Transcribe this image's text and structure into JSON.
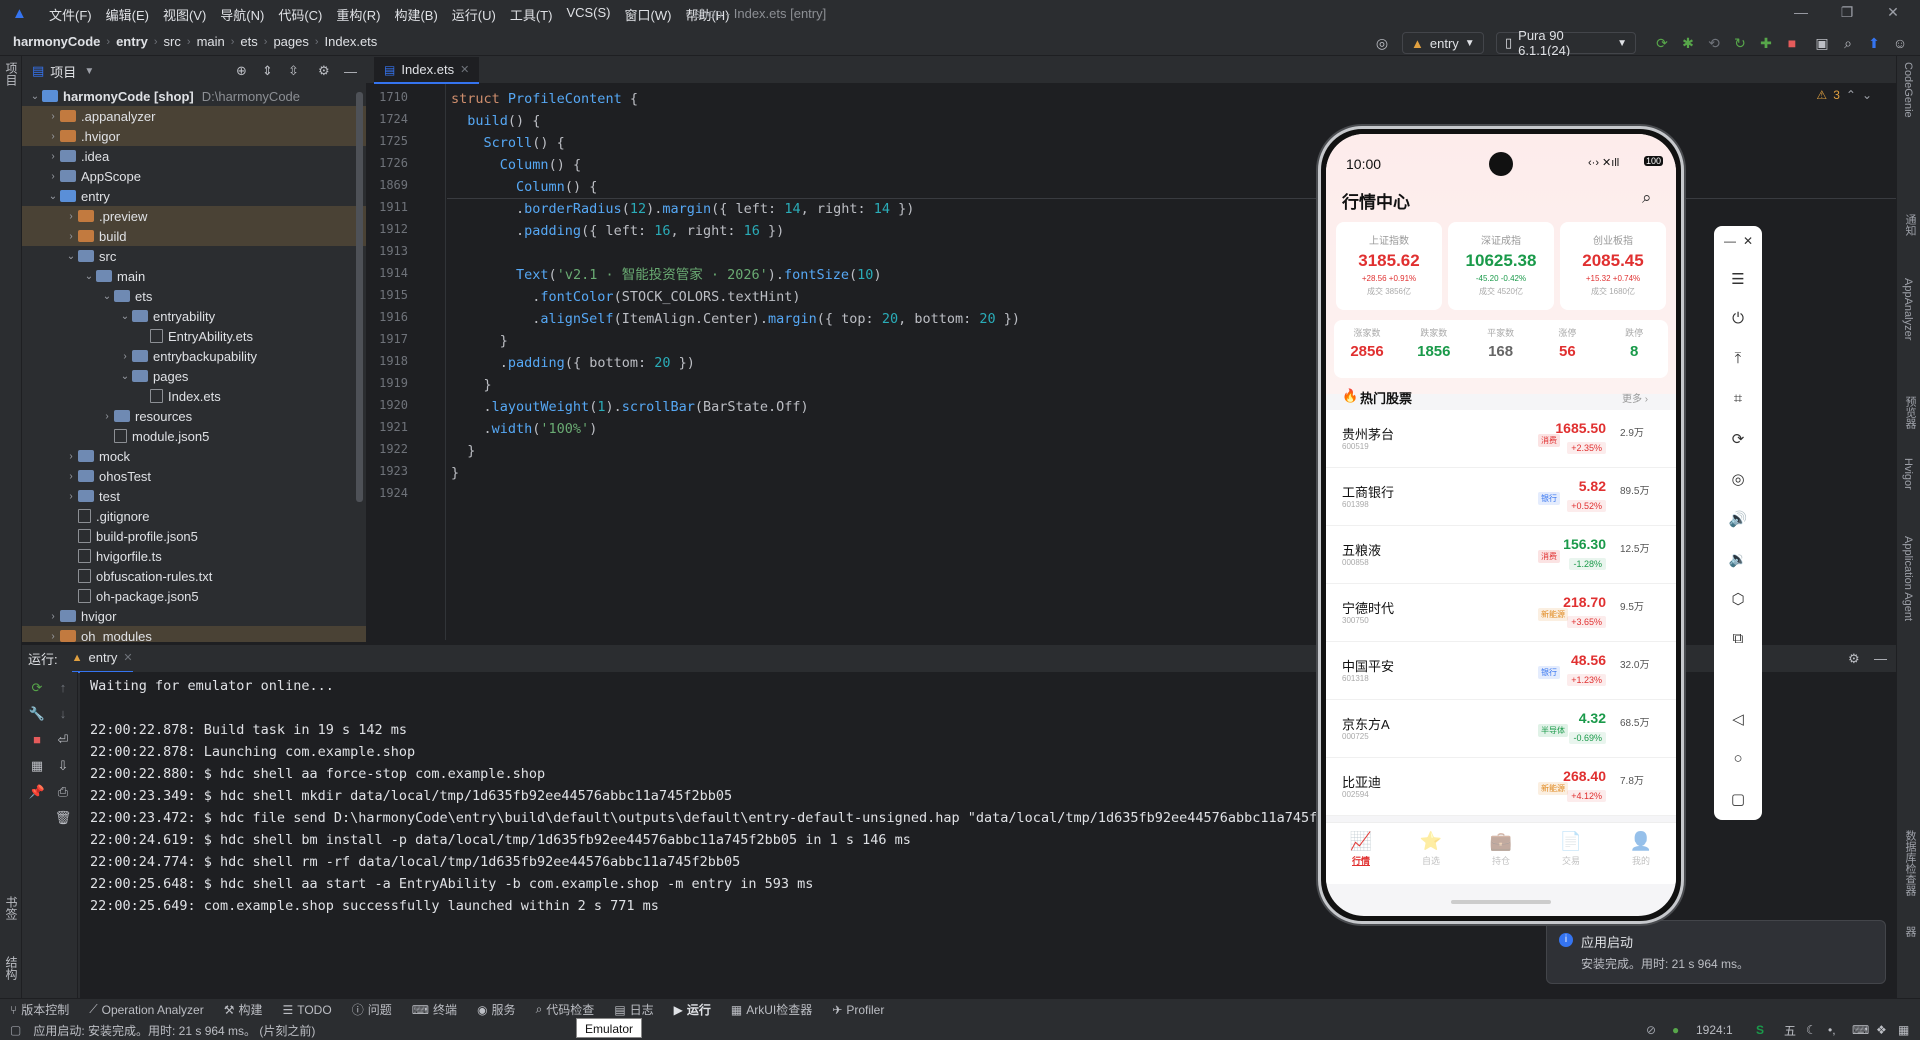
{
  "menu": {
    "items": [
      "文件(F)",
      "编辑(E)",
      "视图(V)",
      "导航(N)",
      "代码(C)",
      "重构(R)",
      "构建(B)",
      "运行(U)",
      "工具(T)",
      "VCS(S)",
      "窗口(W)",
      "帮助(H)"
    ],
    "title": "shop - Index.ets [entry]"
  },
  "breadcrumb": [
    "harmonyCode",
    "entry",
    "src",
    "main",
    "ets",
    "pages",
    "Index.ets"
  ],
  "toolbar": {
    "run_config": "entry",
    "device": "Pura 90 6.1.1(24)"
  },
  "left_strip": {
    "project": "项目",
    "bookmarks": "书签",
    "structure": "结构"
  },
  "project": {
    "header": "项目",
    "tree": [
      {
        "label": "harmonyCode [shop]",
        "path": "D:\\harmonyCode",
        "depth": 0,
        "open": true,
        "kind": "folder-blue"
      },
      {
        "label": ".appanalyzer",
        "depth": 1,
        "open": false,
        "kind": "folder-orange",
        "hl": true
      },
      {
        "label": ".hvigor",
        "depth": 1,
        "open": false,
        "kind": "folder-orange",
        "hl": true
      },
      {
        "label": ".idea",
        "depth": 1,
        "open": false,
        "kind": "folder"
      },
      {
        "label": "AppScope",
        "depth": 1,
        "open": false,
        "kind": "folder"
      },
      {
        "label": "entry",
        "depth": 1,
        "open": true,
        "kind": "folder-blue"
      },
      {
        "label": ".preview",
        "depth": 2,
        "open": false,
        "kind": "folder-orange",
        "hl": true
      },
      {
        "label": "build",
        "depth": 2,
        "open": false,
        "kind": "folder-orange",
        "hl": true
      },
      {
        "label": "src",
        "depth": 2,
        "open": true,
        "kind": "folder"
      },
      {
        "label": "main",
        "depth": 3,
        "open": true,
        "kind": "folder"
      },
      {
        "label": "ets",
        "depth": 4,
        "open": true,
        "kind": "folder"
      },
      {
        "label": "entryability",
        "depth": 5,
        "open": true,
        "kind": "folder"
      },
      {
        "label": "EntryAbility.ets",
        "depth": 6,
        "kind": "file"
      },
      {
        "label": "entrybackupability",
        "depth": 5,
        "open": false,
        "kind": "folder"
      },
      {
        "label": "pages",
        "depth": 5,
        "open": true,
        "kind": "folder"
      },
      {
        "label": "Index.ets",
        "depth": 6,
        "kind": "file"
      },
      {
        "label": "resources",
        "depth": 4,
        "open": false,
        "kind": "folder"
      },
      {
        "label": "module.json5",
        "depth": 4,
        "kind": "file"
      },
      {
        "label": "mock",
        "depth": 2,
        "open": false,
        "kind": "folder"
      },
      {
        "label": "ohosTest",
        "depth": 2,
        "open": false,
        "kind": "folder"
      },
      {
        "label": "test",
        "depth": 2,
        "open": false,
        "kind": "folder"
      },
      {
        "label": ".gitignore",
        "depth": 2,
        "kind": "file"
      },
      {
        "label": "build-profile.json5",
        "depth": 2,
        "kind": "file"
      },
      {
        "label": "hvigorfile.ts",
        "depth": 2,
        "kind": "file"
      },
      {
        "label": "obfuscation-rules.txt",
        "depth": 2,
        "kind": "file"
      },
      {
        "label": "oh-package.json5",
        "depth": 2,
        "kind": "file"
      },
      {
        "label": "hvigor",
        "depth": 1,
        "open": false,
        "kind": "folder"
      },
      {
        "label": "oh_modules",
        "depth": 1,
        "open": false,
        "kind": "folder-orange",
        "hl": true
      }
    ]
  },
  "editor": {
    "tab": "Index.ets",
    "warnings": "3",
    "sticky": [
      {
        "ln": "1710",
        "code": [
          [
            "k",
            "struct "
          ],
          [
            "t",
            "ProfileContent "
          ],
          [
            "p",
            "{"
          ]
        ]
      },
      {
        "ln": "1724",
        "code": [
          [
            "p",
            "  "
          ],
          [
            "t",
            "build"
          ],
          [
            "p",
            "() {"
          ]
        ]
      },
      {
        "ln": "1725",
        "code": [
          [
            "p",
            "    "
          ],
          [
            "t",
            "Scroll"
          ],
          [
            "p",
            "() {"
          ]
        ]
      },
      {
        "ln": "1726",
        "code": [
          [
            "p",
            "      "
          ],
          [
            "t",
            "Column"
          ],
          [
            "p",
            "() {"
          ]
        ]
      },
      {
        "ln": "1869",
        "code": [
          [
            "p",
            "        "
          ],
          [
            "t",
            "Column"
          ],
          [
            "p",
            "() {"
          ]
        ]
      }
    ],
    "lines": [
      {
        "ln": "1911",
        "code": [
          [
            "p",
            "        ."
          ],
          [
            "t",
            "borderRadius"
          ],
          [
            "p",
            "("
          ],
          [
            "n",
            "12"
          ],
          [
            "p",
            ")."
          ],
          [
            "t",
            "margin"
          ],
          [
            "p",
            "({ left: "
          ],
          [
            "n",
            "14"
          ],
          [
            "p",
            ", right: "
          ],
          [
            "n",
            "14"
          ],
          [
            "p",
            " })"
          ]
        ]
      },
      {
        "ln": "1912",
        "code": [
          [
            "p",
            "        ."
          ],
          [
            "t",
            "padding"
          ],
          [
            "p",
            "({ left: "
          ],
          [
            "n",
            "16"
          ],
          [
            "p",
            ", right: "
          ],
          [
            "n",
            "16"
          ],
          [
            "p",
            " })"
          ]
        ]
      },
      {
        "ln": "1913",
        "code": []
      },
      {
        "ln": "1914",
        "code": [
          [
            "p",
            "        "
          ],
          [
            "t",
            "Text"
          ],
          [
            "p",
            "("
          ],
          [
            "s",
            "'v2.1 · 智能投资管家 · 2026'"
          ],
          [
            "p",
            ")."
          ],
          [
            "t",
            "fontSize"
          ],
          [
            "p",
            "("
          ],
          [
            "n",
            "10"
          ],
          [
            "p",
            ")"
          ]
        ]
      },
      {
        "ln": "1915",
        "code": [
          [
            "p",
            "          ."
          ],
          [
            "t",
            "fontColor"
          ],
          [
            "p",
            "(STOCK_COLORS.textHint)"
          ]
        ]
      },
      {
        "ln": "1916",
        "code": [
          [
            "p",
            "          ."
          ],
          [
            "t",
            "alignSelf"
          ],
          [
            "p",
            "(ItemAlign.Center)."
          ],
          [
            "t",
            "margin"
          ],
          [
            "p",
            "({ top: "
          ],
          [
            "n",
            "20"
          ],
          [
            "p",
            ", bottom: "
          ],
          [
            "n",
            "20"
          ],
          [
            "p",
            " })"
          ]
        ]
      },
      {
        "ln": "1917",
        "code": [
          [
            "p",
            "      }"
          ]
        ]
      },
      {
        "ln": "1918",
        "code": [
          [
            "p",
            "      ."
          ],
          [
            "t",
            "padding"
          ],
          [
            "p",
            "({ bottom: "
          ],
          [
            "n",
            "20"
          ],
          [
            "p",
            " })"
          ]
        ]
      },
      {
        "ln": "1919",
        "code": [
          [
            "p",
            "    }"
          ]
        ]
      },
      {
        "ln": "1920",
        "code": [
          [
            "p",
            "    ."
          ],
          [
            "t",
            "layoutWeight"
          ],
          [
            "p",
            "("
          ],
          [
            "n",
            "1"
          ],
          [
            "p",
            ")."
          ],
          [
            "t",
            "scrollBar"
          ],
          [
            "p",
            "(BarState.Off)"
          ]
        ]
      },
      {
        "ln": "1921",
        "code": [
          [
            "p",
            "    ."
          ],
          [
            "t",
            "width"
          ],
          [
            "p",
            "("
          ],
          [
            "s",
            "'100%'"
          ],
          [
            "p",
            ")"
          ]
        ]
      },
      {
        "ln": "1922",
        "code": [
          [
            "p",
            "  }"
          ]
        ]
      },
      {
        "ln": "1923",
        "code": [
          [
            "p",
            "}"
          ]
        ]
      },
      {
        "ln": "1924",
        "code": []
      }
    ]
  },
  "run": {
    "label": "运行:",
    "tab": "entry",
    "console": [
      "Waiting for emulator online...",
      "",
      "22:00:22.878: Build task in 19 s 142 ms",
      "22:00:22.878: Launching com.example.shop",
      "22:00:22.880: $ hdc shell aa force-stop com.example.shop",
      "22:00:23.349: $ hdc shell mkdir data/local/tmp/1d635fb92ee44576abbc11a745f2bb05",
      "22:00:23.472: $ hdc file send D:\\harmonyCode\\entry\\build\\default\\outputs\\default\\entry-default-unsigned.hap \"data/local/tmp/1d635fb92ee44576abbc11a745f2bb",
      "22:00:24.619: $ hdc shell bm install -p data/local/tmp/1d635fb92ee44576abbc11a745f2bb05 in 1 s 146 ms",
      "22:00:24.774: $ hdc shell rm -rf data/local/tmp/1d635fb92ee44576abbc11a745f2bb05",
      "22:00:25.648: $ hdc shell aa start -a EntryAbility -b com.example.shop -m entry in 593 ms",
      "22:00:25.649: com.example.shop successfully launched within 2 s 771 ms"
    ]
  },
  "bottom_tabs": [
    "版本控制",
    "Operation Analyzer",
    "构建",
    "TODO",
    "问题",
    "终端",
    "服务",
    "代码检查",
    "日志",
    "运行",
    "ArkUI检查器",
    "Profiler"
  ],
  "status": {
    "message": "应用启动: 安装完成。用时: 21 s 964 ms。 (片刻之前)",
    "position": "1924:1",
    "tooltip": "Emulator",
    "ime": "五"
  },
  "right_strip": [
    "CodeGenie",
    "通知",
    "AppAnalyzer",
    "预览器",
    "Hvigor",
    "Application Agent",
    "数据库检查器",
    "设备文件浏览器"
  ],
  "notification": {
    "title": "应用启动",
    "body": "安装完成。用时: 21 s 964 ms。"
  },
  "phone": {
    "time": "10:00",
    "battery": "100",
    "header_title": "行情中心",
    "indices": [
      {
        "name": "上证指数",
        "value": "3185.62",
        "change": "+28.56 +0.91%",
        "volume": "成交 3856亿",
        "color": "#e03030"
      },
      {
        "name": "深证成指",
        "value": "10625.38",
        "change": "-45.20 -0.42%",
        "volume": "成交 4520亿",
        "color": "#1a9a4a"
      },
      {
        "name": "创业板指",
        "value": "2085.45",
        "change": "+15.32 +0.74%",
        "volume": "成交 1680亿",
        "color": "#e03030"
      }
    ],
    "breadth": [
      {
        "label": "涨家数",
        "value": "2856",
        "color": "#e03030"
      },
      {
        "label": "跌家数",
        "value": "1856",
        "color": "#1a9a4a"
      },
      {
        "label": "平家数",
        "value": "168",
        "color": "#666666"
      },
      {
        "label": "涨停",
        "value": "56",
        "color": "#e03030"
      },
      {
        "label": "跌停",
        "value": "8",
        "color": "#1a9a4a"
      }
    ],
    "hot_title": "热门股票",
    "more": "更多 ›",
    "stocks": [
      {
        "name": "贵州茅台",
        "code": "600519",
        "tag": "消费",
        "tag_color": "#e03030",
        "price": "1685.50",
        "pct": "+2.35%",
        "vol": "2.9万",
        "up": true
      },
      {
        "name": "工商银行",
        "code": "601398",
        "tag": "银行",
        "tag_color": "#3574f0",
        "price": "5.82",
        "pct": "+0.52%",
        "vol": "89.5万",
        "up": true
      },
      {
        "name": "五粮液",
        "code": "000858",
        "tag": "消费",
        "tag_color": "#e03030",
        "price": "156.30",
        "pct": "-1.28%",
        "vol": "12.5万",
        "up": false
      },
      {
        "name": "宁德时代",
        "code": "300750",
        "tag": "新能源",
        "tag_color": "#e08a20",
        "price": "218.70",
        "pct": "+3.65%",
        "vol": "9.5万",
        "up": true
      },
      {
        "name": "中国平安",
        "code": "601318",
        "tag": "银行",
        "tag_color": "#3574f0",
        "price": "48.56",
        "pct": "+1.23%",
        "vol": "32.0万",
        "up": true
      },
      {
        "name": "京东方A",
        "code": "000725",
        "tag": "半导体",
        "tag_color": "#1a9a4a",
        "price": "4.32",
        "pct": "-0.69%",
        "vol": "68.5万",
        "up": false
      },
      {
        "name": "比亚迪",
        "code": "002594",
        "tag": "新能源",
        "tag_color": "#e08a20",
        "price": "268.40",
        "pct": "+4.12%",
        "vol": "7.8万",
        "up": true
      }
    ],
    "nav": [
      "行情",
      "自选",
      "持仓",
      "交易",
      "我的"
    ],
    "colors": {
      "up": "#e03030",
      "down": "#1a9a4a",
      "header_bg": "#fdeceb"
    }
  }
}
